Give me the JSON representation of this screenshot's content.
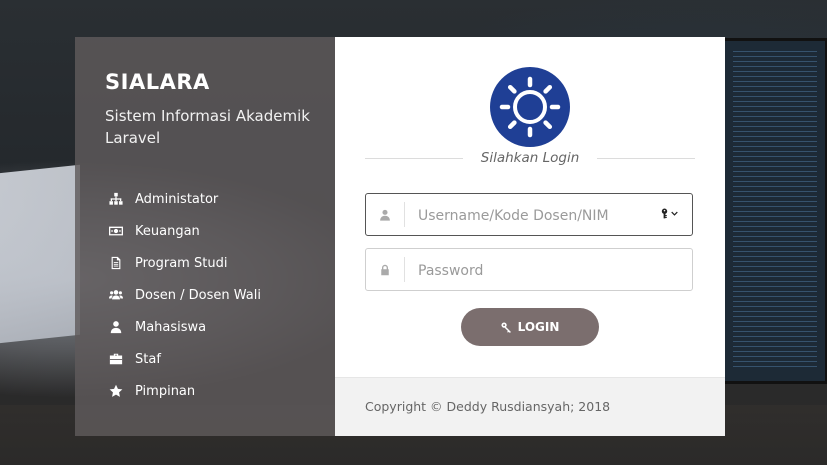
{
  "app": {
    "title": "SIALARA",
    "subtitle": "Sistem Informasi Akademik Laravel"
  },
  "nav": {
    "items": [
      {
        "label": "Administator",
        "icon": "sitemap-icon"
      },
      {
        "label": "Keuangan",
        "icon": "money-icon"
      },
      {
        "label": "Program Studi",
        "icon": "document-icon"
      },
      {
        "label": "Dosen / Dosen Wali",
        "icon": "users-icon"
      },
      {
        "label": "Mahasiswa",
        "icon": "user-icon"
      },
      {
        "label": "Staf",
        "icon": "briefcase-icon"
      },
      {
        "label": "Pimpinan",
        "icon": "star-icon"
      }
    ]
  },
  "login": {
    "heading": "Silahkan Login",
    "username": {
      "placeholder": "Username/Kode Dosen/NIM",
      "value": ""
    },
    "password": {
      "placeholder": "Password",
      "value": ""
    },
    "button_label": "LOGIN"
  },
  "footer": {
    "copyright": "Copyright © Deddy Rusdiansyah; 2018"
  },
  "colors": {
    "logo_blue": "#1f3f95",
    "button": "#7b6e6e",
    "left_panel": "#5f5a5c"
  }
}
